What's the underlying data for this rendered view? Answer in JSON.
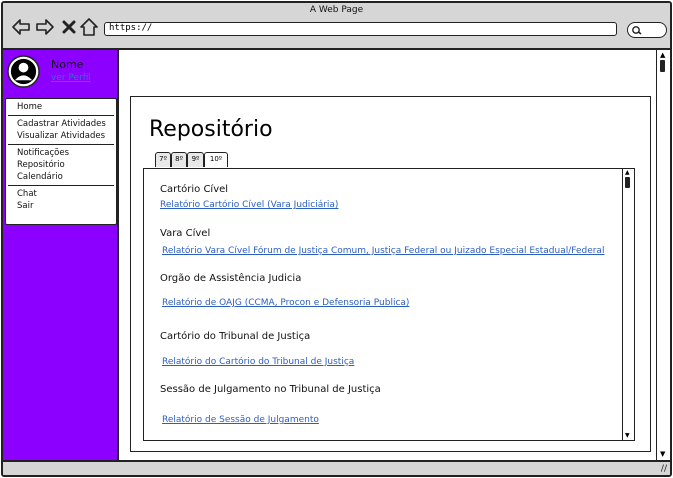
{
  "window": {
    "title": "A Web Page"
  },
  "browser": {
    "url": "https://"
  },
  "user": {
    "name": "Nome",
    "profile_link": "ver Perfil"
  },
  "sidebar": {
    "groups": [
      [
        "Home"
      ],
      [
        "Cadastrar Atividades",
        "Visualizar Atividades"
      ],
      [
        "Notificações",
        "Repositório",
        "Calendário"
      ],
      [
        "Chat",
        "Sair"
      ]
    ]
  },
  "page": {
    "title": "Repositório",
    "tabs": [
      "7º",
      "8º",
      "9º",
      "10º"
    ],
    "sections": [
      {
        "heading": "Cartório Cível",
        "link": "Relatório Cartório Cível (Vara Judiciária)"
      },
      {
        "heading": "Vara Cível",
        "link": "Relatório Vara Cível Fórum de Justiça Comum, Justiça Federal ou Juizado Especial Estadual/Federal"
      },
      {
        "heading": "Orgão de Assistência Judicia",
        "link": "Relatório de OAJG (CCMA, Procon e Defensoria Publica)"
      },
      {
        "heading": "Cartório do Tribunal de Justiça",
        "link": "Relatório do Cartório do Tribunal de Justiça"
      },
      {
        "heading": "Sessão de Julgamento no Tribunal de Justiça",
        "link": "Relatório de Sessão de Julgamento"
      }
    ]
  },
  "colors": {
    "sidebar": "#8c00ff",
    "chrome": "#d6d6d6",
    "link": "#2c5fc0"
  }
}
